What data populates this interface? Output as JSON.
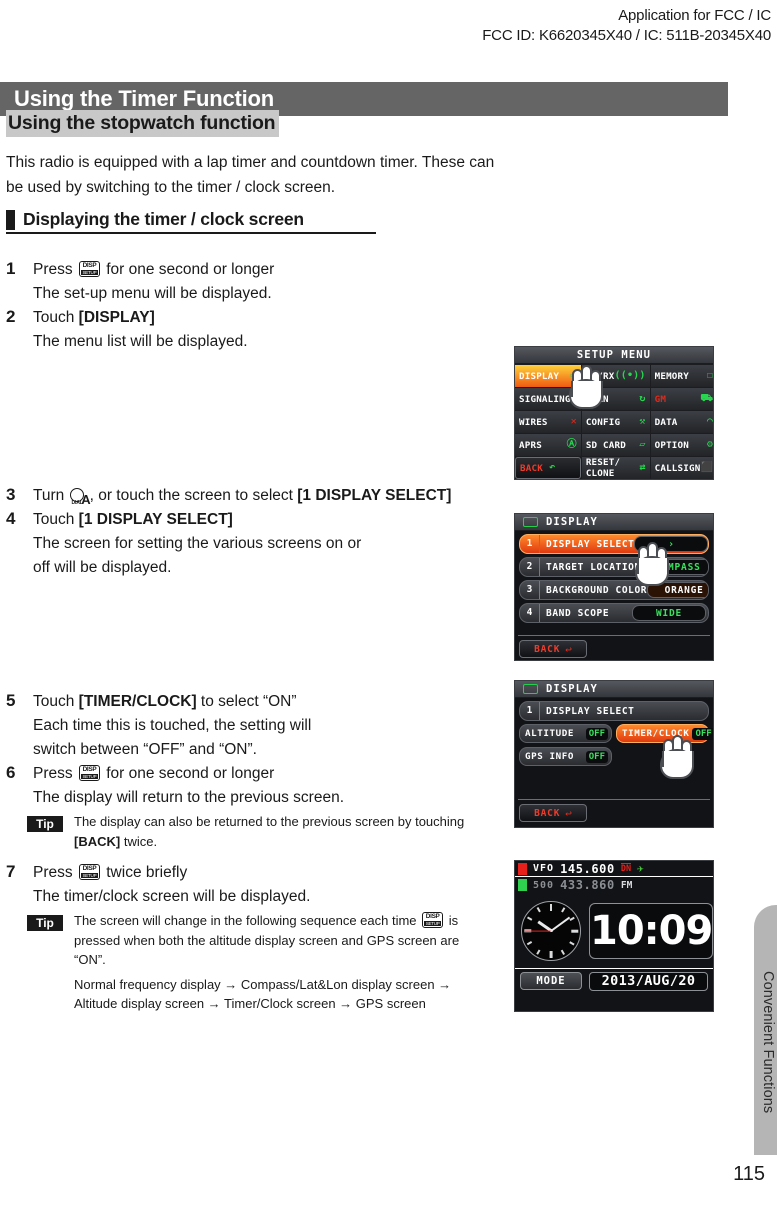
{
  "stamp": {
    "line1": "Application for FCC /  IC",
    "line2": "FCC ID: K6620345X40 /  IC: 511B-20345X40"
  },
  "title_bar": {
    "title": "Using the Timer Function"
  },
  "section_heading": "Using the stopwatch function",
  "intro": "This radio is equipped with a lap timer and countdown timer. These can be used by switching to the timer / clock screen.",
  "sub_heading": "Displaying the timer / clock screen",
  "steps": [
    {
      "num": "1",
      "main_before": "Press ",
      "key": "DISP",
      "main_after": " for one second or longer",
      "sub": "The set-up menu will be displayed."
    },
    {
      "num": "2",
      "main_before": "Touch ",
      "bold": "[DISPLAY]",
      "main_after": "",
      "sub": "The menu list will be displayed."
    },
    {
      "num": "3",
      "main_before": "Turn ",
      "key": "DIAL",
      "main_mid": ", or touch the screen to select ",
      "bold": "[1 DISPLAY SELECT]",
      "main_after": ""
    },
    {
      "num": "4",
      "main_before": "Touch ",
      "bold": "[1 DISPLAY SELECT]",
      "main_after": "",
      "sub": "The screen for setting the various screens on or off will be displayed."
    },
    {
      "num": "5",
      "main_before": "Touch ",
      "bold": "[TIMER/CLOCK]",
      "main_after": " to select “ON”",
      "sub": "Each time this is touched, the setting will switch between “OFF” and “ON”."
    },
    {
      "num": "6",
      "main_before": "Press ",
      "key": "DISP",
      "main_after": " for one second or longer",
      "sub": "The display will return to the previous screen.",
      "tip": {
        "badge": "Tip",
        "line1_a": "The display can also be returned to the previous screen by touching ",
        "line1_b": "[BACK]",
        "line1_c": " twice."
      }
    },
    {
      "num": "7",
      "main_before": "Press ",
      "key": "DISP",
      "main_after": " twice briefly",
      "sub": "The timer/clock screen will be displayed.",
      "tip": {
        "badge": "Tip",
        "para1_a": "The screen will change in the following sequence each time ",
        "para1_b": " is pressed when both the altitude display screen and GPS screen are “ON”.",
        "para2": "Normal frequency display → Compass/Lat&Lon display screen → Altitude display screen → Timer/Clock screen → GPS screen"
      }
    }
  ],
  "screens": {
    "setup_menu": {
      "title": "SETUP MENU",
      "cells": [
        {
          "label": "DISPLAY",
          "icon": "display-icon",
          "glyph": "▭",
          "highlighted": true
        },
        {
          "label": "TX/RX",
          "icon": "antenna-icon",
          "glyph": "((•))",
          "highlighted": false
        },
        {
          "label": "MEMORY",
          "icon": "book-icon",
          "glyph": "☐",
          "highlighted": false
        },
        {
          "label": "SIGNALING",
          "icon": "bars-icon",
          "glyph": "‖",
          "highlighted": false
        },
        {
          "label": "SCAN",
          "icon": "circle-arrow-icon",
          "glyph": "↻",
          "highlighted": false
        },
        {
          "label": "GM",
          "icon": "people-icon",
          "glyph": "⛟",
          "highlighted": false
        },
        {
          "label": "WIRES",
          "icon": "x-icon",
          "glyph": "✕",
          "highlighted": false
        },
        {
          "label": "CONFIG",
          "icon": "wrench-icon",
          "glyph": "⚒",
          "highlighted": false
        },
        {
          "label": "DATA",
          "icon": "signal-icon",
          "glyph": "◠",
          "highlighted": false
        },
        {
          "label": "APRS",
          "icon": "a-circle-icon",
          "glyph": "Ⓐ",
          "highlighted": false
        },
        {
          "label": "SD CARD",
          "icon": "card-icon",
          "glyph": "▱",
          "highlighted": false
        },
        {
          "label": "OPTION",
          "icon": "gear-icon",
          "glyph": "⚙",
          "highlighted": false
        },
        {
          "label": "BACK",
          "icon": "back-arrow-icon",
          "glyph": "↶",
          "highlighted": false
        },
        {
          "label": "RESET/ CLONE",
          "icon": "swap-icon",
          "glyph": "⇄",
          "highlighted": false
        },
        {
          "label": "CALLSIGN",
          "icon": "tag-icon",
          "glyph": "⬛",
          "highlighted": false
        }
      ]
    },
    "display_menu": {
      "title": "DISPLAY",
      "rows": [
        {
          "idx": "1",
          "name": "DISPLAY SELECT",
          "value": "›",
          "selected": true,
          "value_style": "green"
        },
        {
          "idx": "2",
          "name": "TARGET LOCATION",
          "value": "COMPASS",
          "selected": false,
          "value_style": "green"
        },
        {
          "idx": "3",
          "name": "BACKGROUND COLOR",
          "value": "ORANGE",
          "selected": false,
          "value_style": "amber"
        },
        {
          "idx": "4",
          "name": "BAND SCOPE",
          "value": "WIDE",
          "selected": false,
          "value_style": "green"
        }
      ],
      "back": "BACK"
    },
    "display_select": {
      "title": "DISPLAY",
      "header_idx": "1",
      "header_name": "DISPLAY SELECT",
      "chips": [
        {
          "label": "ALTITUDE",
          "value": "OFF",
          "selected": false
        },
        {
          "label": "TIMER/CLOCK",
          "value": "OFF",
          "selected": true
        },
        {
          "label": "GPS INFO",
          "value": "OFF",
          "selected": false
        }
      ],
      "back": "BACK"
    },
    "clock_screen": {
      "vfo_label": "VFO",
      "vfo_freq": "145.600",
      "vfo_dn": "DN",
      "vfo_gps_icon": "gps-icon",
      "sub_label": "500",
      "sub_freq": "433.860",
      "sub_mode": "FM",
      "digital_time": "10:09",
      "mode_button": "MODE",
      "date": "2013/AUG/20",
      "analog_clock": {
        "hour": 10,
        "minute": 9,
        "second": 45
      }
    }
  },
  "sidebar": {
    "label": "Convenient Functions"
  },
  "page_number": "115"
}
